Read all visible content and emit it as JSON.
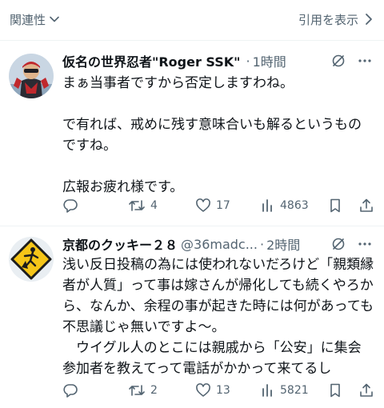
{
  "topbar": {
    "sort_label": "関連性",
    "quotes_label": "引用を表示"
  },
  "tweets": [
    {
      "name": "仮名の世界忍者\"Roger SSK\"",
      "handle": "",
      "time": "1時間",
      "paragraphs": [
        "まぁ当事者ですから否定しますわね。",
        "で有れば、戒めに残す意味合いも解るというものですね。",
        "広報お疲れ様です。"
      ],
      "replies": "",
      "retweets": "4",
      "likes": "17",
      "views": "4863"
    },
    {
      "name": "京都のクッキー２８",
      "handle": "@36madc...",
      "time": "2時間",
      "paragraphs": [
        "浅い反日投稿の為には使われないだろけど「親類縁者が人質」って事は嫁さんが帰化しても続くやろから、なんか、余程の事が起きた時には何があっても不思議じゃ無いですよ〜。",
        "　ウイグル人のとこには親戚から「公安」に集会参加者を教えてって電話がかかって来てるし"
      ],
      "replies": "",
      "retweets": "2",
      "likes": "13",
      "views": "5821"
    }
  ],
  "colors": {
    "text_primary": "#0f1419",
    "text_secondary": "#536471",
    "divider": "#eff3f4"
  }
}
